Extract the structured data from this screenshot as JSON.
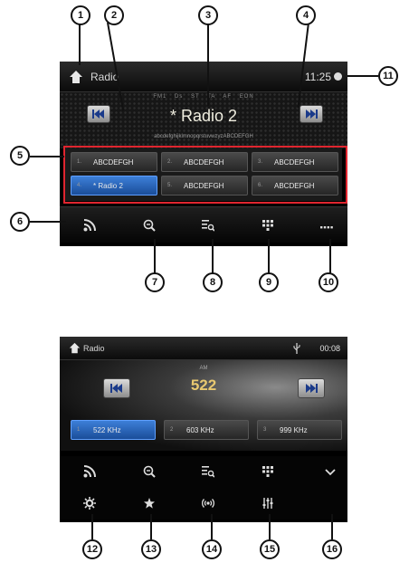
{
  "screen1": {
    "title": "Radio",
    "time": "11:25",
    "rds_flags": "FM1  Ds  ST  TA  AF  EON",
    "station": "* Radio 2",
    "radio_text": "abcdefghijklmnopqrstuvwzyzABCDEFGH",
    "presets": [
      {
        "num": "1.",
        "label": "ABCDEFGH",
        "active": false
      },
      {
        "num": "2.",
        "label": "ABCDEFGH",
        "active": false
      },
      {
        "num": "3.",
        "label": "ABCDEFGH",
        "active": false
      },
      {
        "num": "4.",
        "label": "* Radio 2",
        "active": true
      },
      {
        "num": "5.",
        "label": "ABCDEFGH",
        "active": false
      },
      {
        "num": "6.",
        "label": "ABCDEFGH",
        "active": false
      }
    ],
    "toolbar_icons": [
      "rss-icon",
      "zoom-out-icon",
      "list-search-icon",
      "keypad-icon",
      "more-icon"
    ]
  },
  "screen2": {
    "title": "Radio",
    "time": "00:08",
    "band": "AM",
    "frequency": "522",
    "presets": [
      {
        "num": "1",
        "label": "522 KHz",
        "active": true
      },
      {
        "num": "2",
        "label": "603 KHz",
        "active": false
      },
      {
        "num": "3",
        "label": "999 KHz",
        "active": false
      }
    ],
    "toolbar_icons_row1": [
      "rss-icon",
      "zoom-out-icon",
      "list-search-icon",
      "keypad-icon",
      "chevron-down-icon"
    ],
    "toolbar_icons_row2": [
      "settings-icon",
      "favorite-icon",
      "broadcast-icon",
      "equalizer-icon"
    ]
  },
  "callouts": [
    "1",
    "2",
    "3",
    "4",
    "5",
    "6",
    "7",
    "8",
    "9",
    "10",
    "11",
    "12",
    "13",
    "14",
    "15",
    "16"
  ],
  "colors": {
    "accent_blue": "#2e6fd0",
    "highlight_red": "#e0252f",
    "frequency_gold": "#e8c870"
  }
}
